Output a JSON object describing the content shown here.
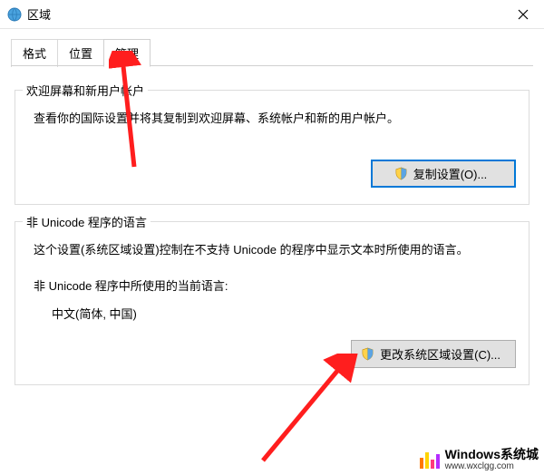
{
  "titlebar": {
    "title": "区域"
  },
  "tabs": {
    "items": [
      {
        "label": "格式"
      },
      {
        "label": "位置"
      },
      {
        "label": "管理"
      }
    ]
  },
  "group1": {
    "legend": "欢迎屏幕和新用户帐户",
    "desc": "查看你的国际设置并将其复制到欢迎屏幕、系统帐户和新的用户帐户。",
    "button": "复制设置(O)..."
  },
  "group2": {
    "legend": "非 Unicode 程序的语言",
    "desc": "这个设置(系统区域设置)控制在不支持 Unicode 的程序中显示文本时所使用的语言。",
    "current_label": "非 Unicode 程序中所使用的当前语言:",
    "current_value": "中文(简体, 中国)",
    "button": "更改系统区域设置(C)..."
  },
  "watermark": {
    "brand_prefix": "W",
    "brand_rest": "indows系统城",
    "url": "www.wxclgg.com"
  }
}
